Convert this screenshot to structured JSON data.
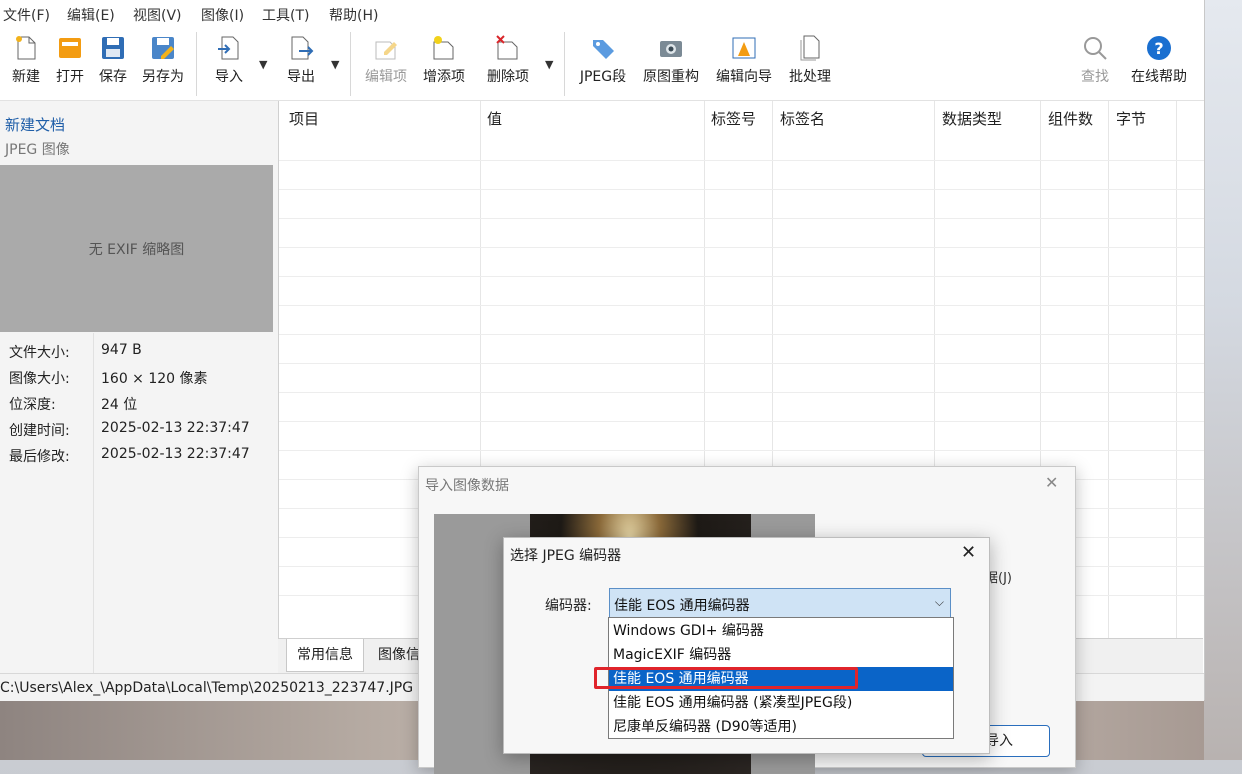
{
  "menu": [
    "文件(F)",
    "编辑(E)",
    "视图(V)",
    "图像(I)",
    "工具(T)",
    "帮助(H)"
  ],
  "toolbar": {
    "new": "新建",
    "open": "打开",
    "save": "保存",
    "save_as": "另存为",
    "import": "导入",
    "export": "导出",
    "edit_item": "编辑项",
    "add_item": "增添项",
    "delete_item": "删除项",
    "jpeg_segment": "JPEG段",
    "rebuild": "原图重构",
    "edit_wizard": "编辑向导",
    "batch": "批处理",
    "find": "查找",
    "help": "在线帮助",
    "dropdown_glyph": "▼"
  },
  "doc": {
    "title": "新建文档",
    "subtitle": "JPEG 图像",
    "no_thumbnail": "无 EXIF 缩略图"
  },
  "properties": [
    {
      "key": "文件大小:",
      "value": "947 B"
    },
    {
      "key": "图像大小:",
      "value": "160 × 120 像素"
    },
    {
      "key": "位深度:",
      "value": "24 位"
    },
    {
      "key": "创建时间:",
      "value": "2025-02-13 22:37:47"
    },
    {
      "key": "最后修改:",
      "value": "2025-02-13 22:37:47"
    }
  ],
  "grid": {
    "columns": [
      "项目",
      "值",
      "标签号",
      "标签名",
      "数据类型",
      "组件数",
      "字节"
    ]
  },
  "tabs": [
    "常用信息",
    "图像信"
  ],
  "status": {
    "path": "C:\\Users\\Alex_\\AppData\\Local\\Temp\\20250213_223747.JPG"
  },
  "import_dialog": {
    "title": "导入图像数据",
    "close": "✕",
    "fragment1": ")",
    "fragment2": "据(J)",
    "import_button": "导入"
  },
  "encoder_dialog": {
    "title": "选择 JPEG 编码器",
    "close": "✕",
    "label": "编码器:",
    "selected": "佳能 EOS 通用编码器",
    "chevron": "⌵",
    "options": [
      "Windows GDI+ 编码器",
      "MagicEXIF 编码器",
      "佳能 EOS 通用编码器",
      "佳能 EOS 通用编码器 (紧凑型JPEG段)",
      "尼康单反编码器 (D90等适用)"
    ],
    "highlighted_index": 2
  },
  "colors": {
    "accent": "#0a64c8",
    "highlight_border": "#e0242b",
    "link": "#1f5ea8"
  }
}
